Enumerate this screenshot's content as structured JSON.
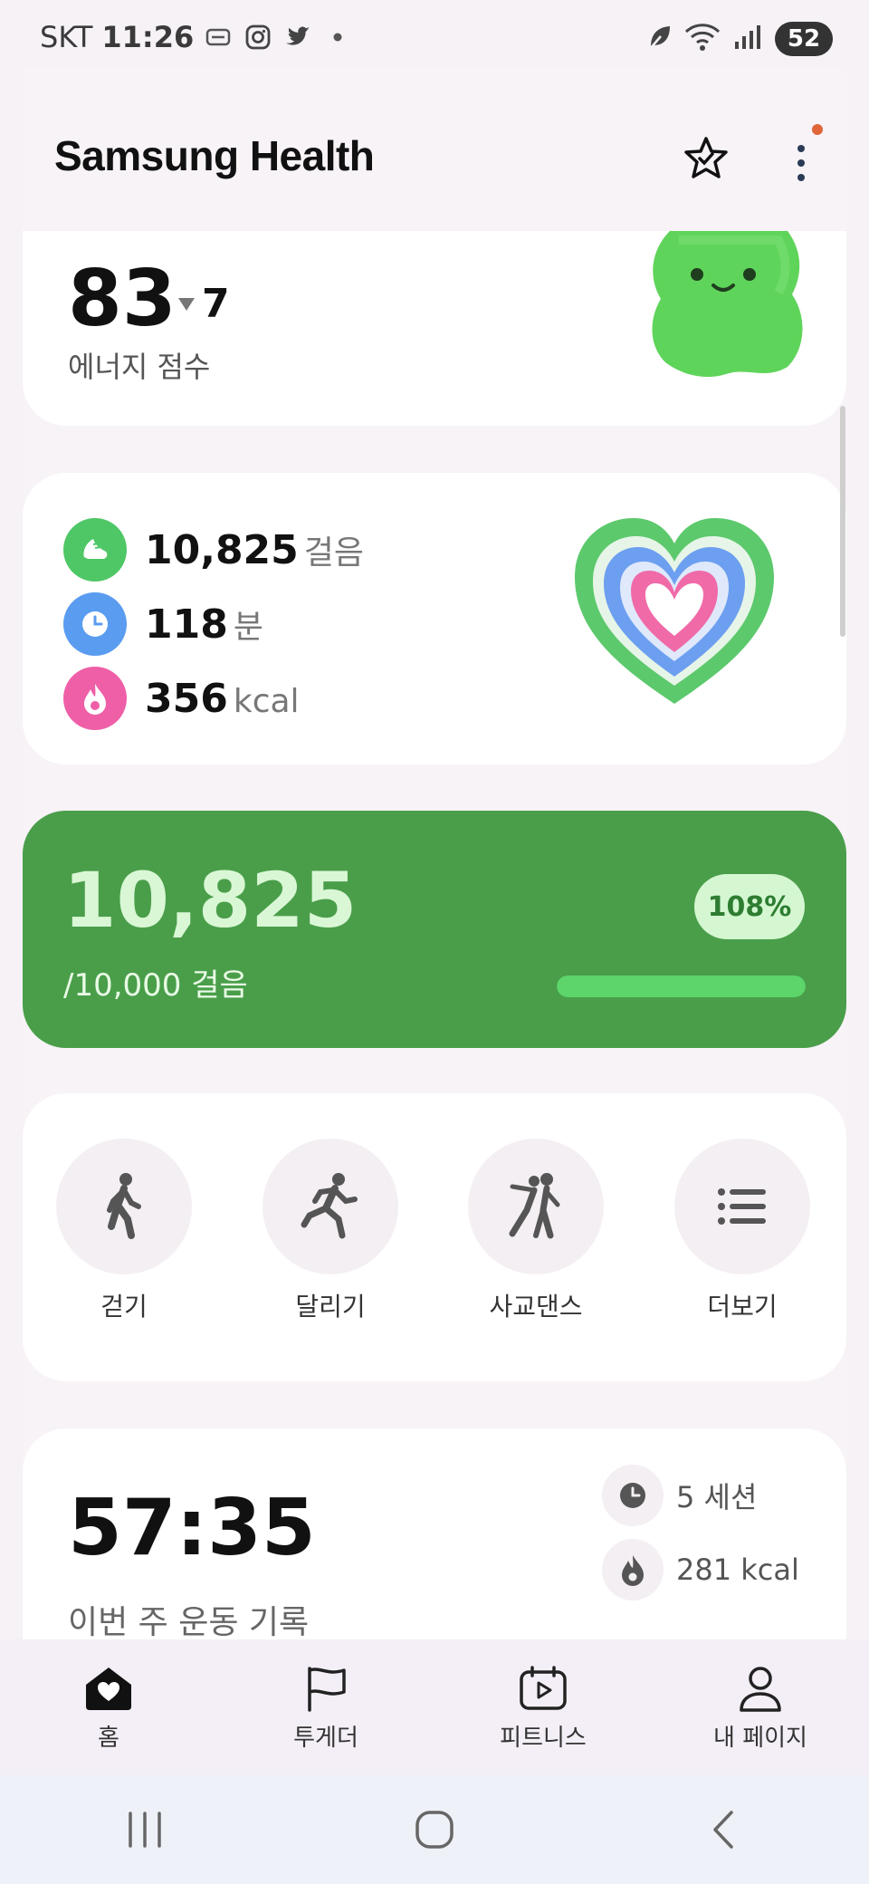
{
  "status_bar": {
    "carrier": "SKT",
    "time": "11:26",
    "battery": "52",
    "icons": [
      "usb-icon",
      "instagram-icon",
      "twitter-icon",
      "dot-icon",
      "leaf-icon",
      "wifi-icon",
      "signal-icon"
    ]
  },
  "header": {
    "title": "Samsung Health",
    "icons": [
      "star-check-icon",
      "more-vertical-icon"
    ]
  },
  "energy": {
    "score": "83",
    "change": "7",
    "label": "에너지 점수"
  },
  "activity": {
    "steps_value": "10,825",
    "steps_unit": "걸음",
    "minutes_value": "118",
    "minutes_unit": "분",
    "calories_value": "356",
    "calories_unit": "kcal",
    "colors": {
      "steps": "#4fc766",
      "minutes": "#5a9cf0",
      "calories": "#ee5fa8"
    }
  },
  "step_goal": {
    "count": "10,825",
    "goal_text": "/10,000 걸음",
    "percent_label": "108%",
    "progress_fraction": 1.0
  },
  "workouts": {
    "items": [
      {
        "label": "걷기",
        "icon": "walking-icon"
      },
      {
        "label": "달리기",
        "icon": "running-icon"
      },
      {
        "label": "사교댄스",
        "icon": "dance-icon"
      },
      {
        "label": "더보기",
        "icon": "list-icon"
      }
    ]
  },
  "weekly": {
    "time": "57:35",
    "label": "이번 주 운동 기록",
    "sessions": "5 세션",
    "calories": "281 kcal"
  },
  "bottom_nav": {
    "items": [
      {
        "label": "홈",
        "icon": "home-heart-icon",
        "active": true
      },
      {
        "label": "투게더",
        "icon": "flag-icon",
        "active": false
      },
      {
        "label": "피트니스",
        "icon": "play-calendar-icon",
        "active": false
      },
      {
        "label": "내 페이지",
        "icon": "person-icon",
        "active": false
      }
    ]
  },
  "system_nav": {
    "icons": [
      "recent-apps-icon",
      "home-circle-icon",
      "back-icon"
    ]
  }
}
